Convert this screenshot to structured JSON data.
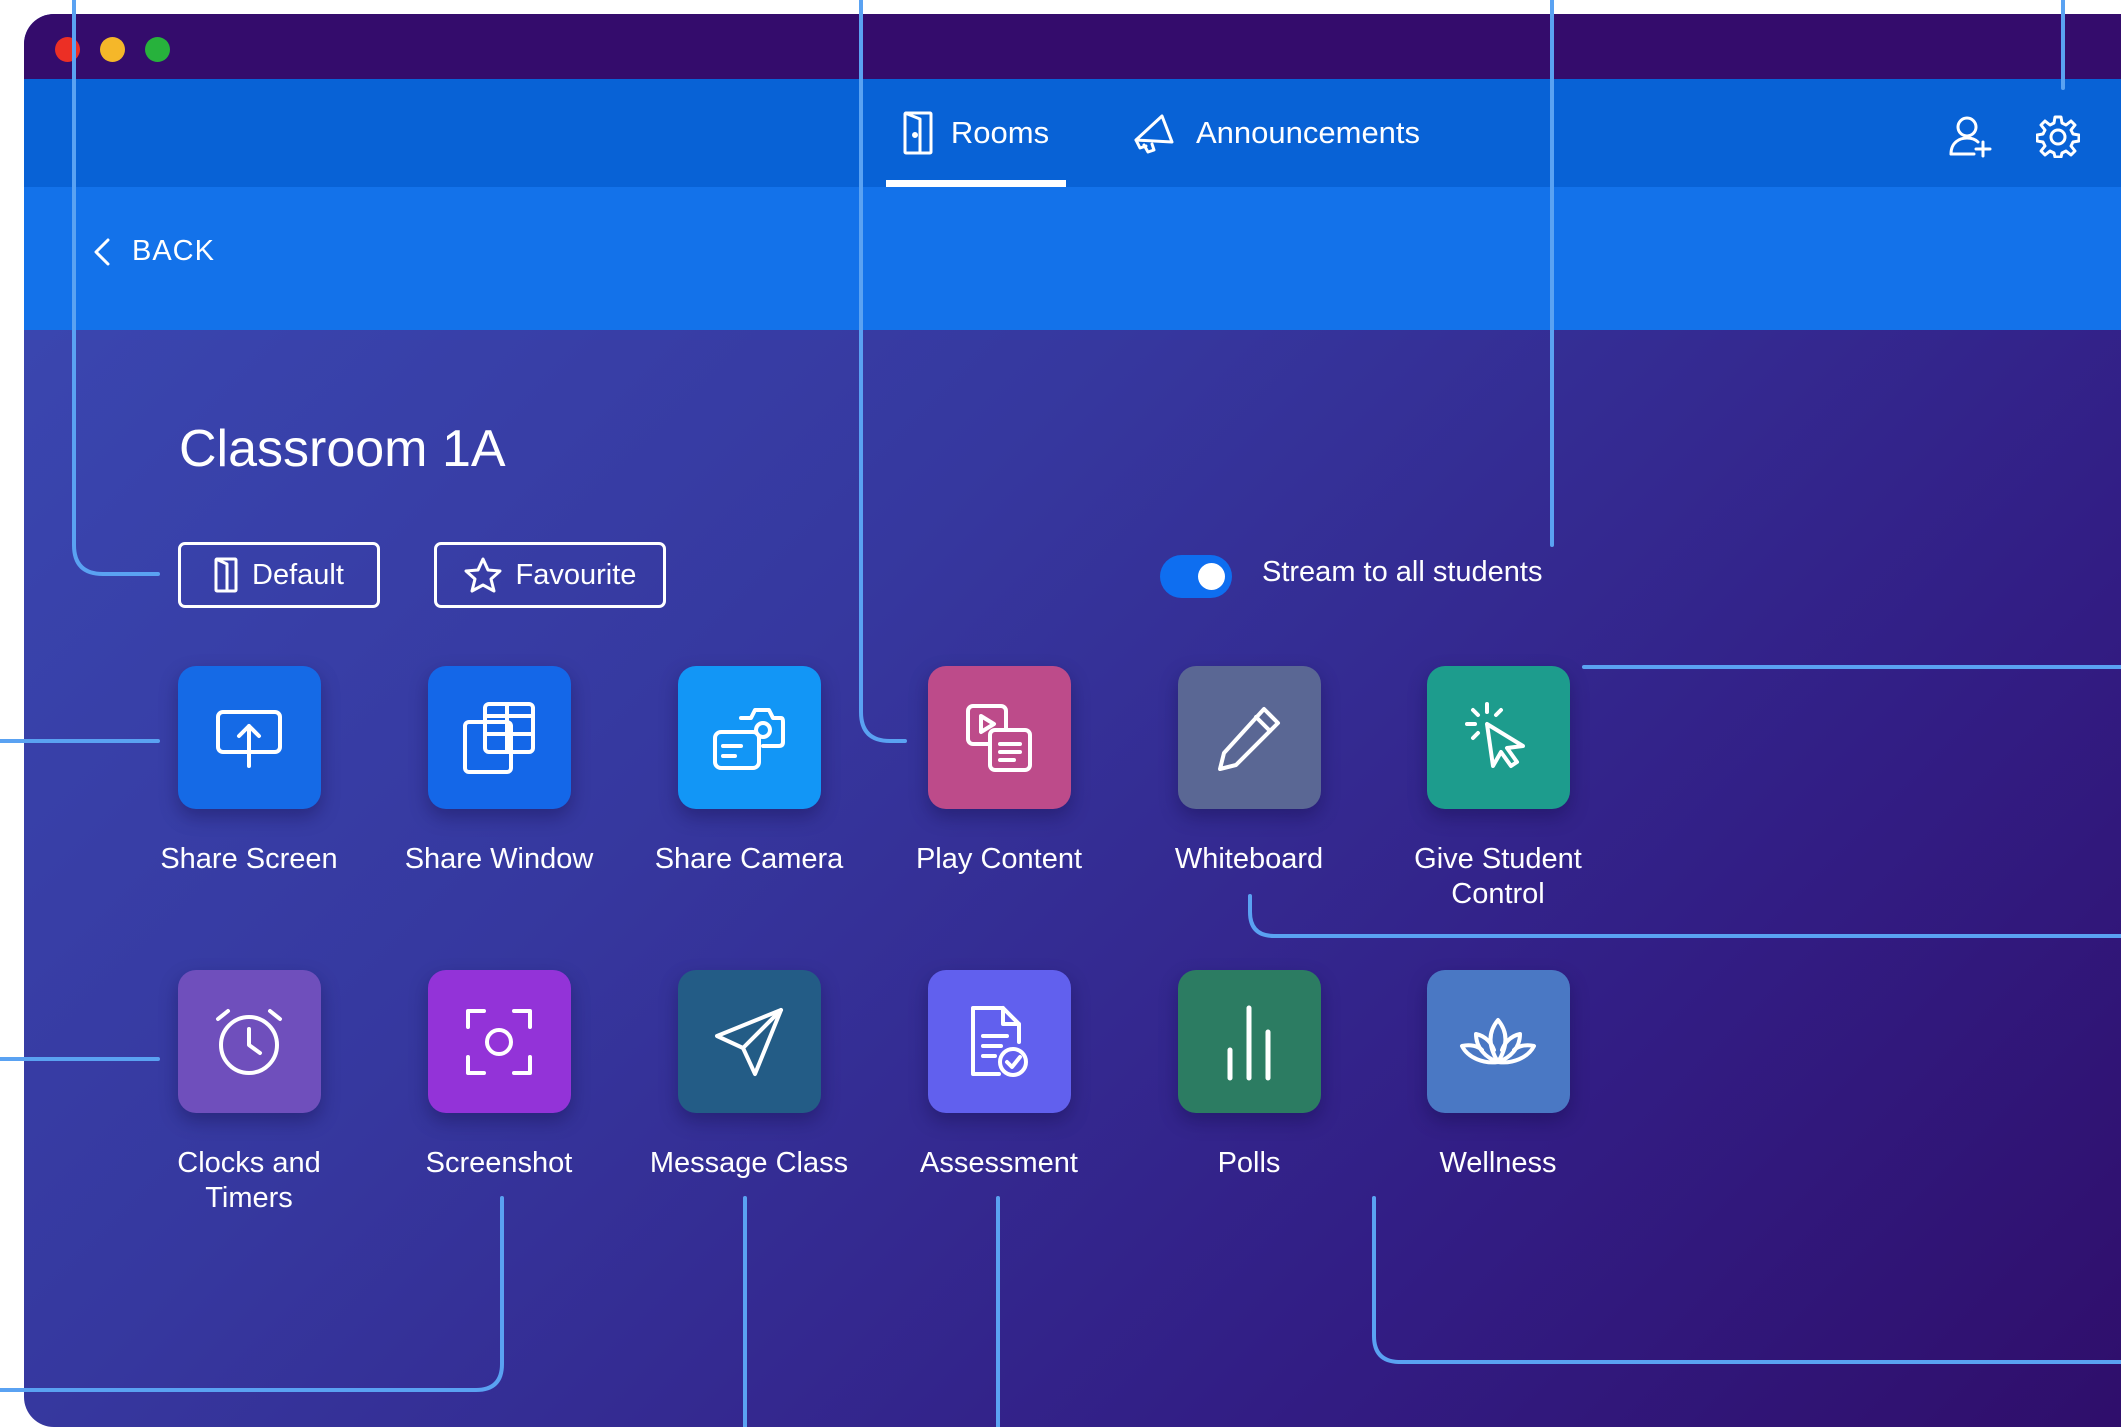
{
  "window": {
    "title_controls": [
      "close",
      "minimize",
      "maximize"
    ]
  },
  "nav": {
    "tabs": [
      {
        "label": "Rooms",
        "icon": "door-icon",
        "active": true
      },
      {
        "label": "Announcements",
        "icon": "megaphone-icon",
        "active": false
      }
    ],
    "actions": [
      "add-user-icon",
      "gear-icon"
    ]
  },
  "back": {
    "label": "BACK"
  },
  "room": {
    "title": "Classroom 1A",
    "default_label": "Default",
    "favourite_label": "Favourite",
    "stream": {
      "label": "Stream to all students",
      "enabled": true
    }
  },
  "tiles": [
    {
      "label": "Share Screen",
      "color": "#156ae6",
      "icon": "share-screen-icon"
    },
    {
      "label": "Share Window",
      "color": "#1467e8",
      "icon": "share-window-icon"
    },
    {
      "label": "Share Camera",
      "color": "#1296f6",
      "icon": "camera-icon"
    },
    {
      "label": "Play Content",
      "color": "#bd4b8a",
      "icon": "play-content-icon"
    },
    {
      "label": "Whiteboard",
      "color": "#5a6794",
      "icon": "pencil-icon"
    },
    {
      "label": "Give Student Control",
      "color": "#1d9c8d",
      "icon": "cursor-click-icon"
    },
    {
      "label": "Clocks and Timers",
      "color": "#6f4fbc",
      "icon": "alarm-clock-icon"
    },
    {
      "label": "Screenshot",
      "color": "#9333d8",
      "icon": "screenshot-icon"
    },
    {
      "label": "Message Class",
      "color": "#235c86",
      "icon": "paper-plane-icon"
    },
    {
      "label": "Assessment",
      "color": "#6160ee",
      "icon": "assessment-icon"
    },
    {
      "label": "Polls",
      "color": "#2c7c62",
      "icon": "bar-chart-icon"
    },
    {
      "label": "Wellness",
      "color": "#4a78c4",
      "icon": "lotus-icon"
    }
  ]
}
